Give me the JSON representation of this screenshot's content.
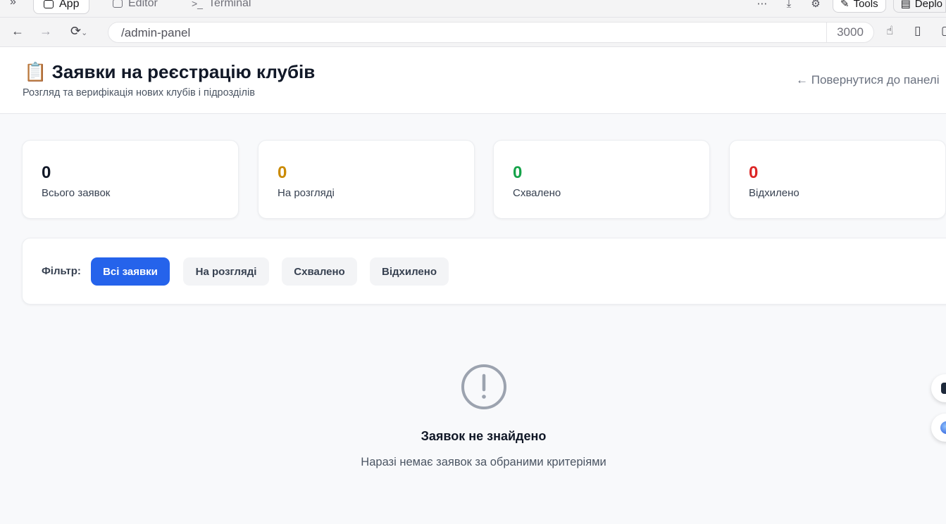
{
  "ide": {
    "tabs": [
      {
        "label": "App",
        "active": true
      },
      {
        "label": "Editor",
        "active": false
      },
      {
        "label": "Terminal",
        "active": false
      }
    ],
    "tools_label": "Tools",
    "deploy_label": "Deplo"
  },
  "browser": {
    "url": "/admin-panel",
    "port": "3000"
  },
  "header": {
    "icon": "📋",
    "title": "Заявки на реєстрацію клубів",
    "subtitle": "Розгляд та верифікація нових клубів і підрозділів",
    "back_link": "← Повернутися до панелі"
  },
  "stats": [
    {
      "value": "0",
      "label": "Всього заявок",
      "color": "#111827"
    },
    {
      "value": "0",
      "label": "На розгляді",
      "color": "#ca8a04"
    },
    {
      "value": "0",
      "label": "Схвалено",
      "color": "#16a34a"
    },
    {
      "value": "0",
      "label": "Відхилено",
      "color": "#dc2626"
    }
  ],
  "filter": {
    "label": "Фільтр:",
    "options": [
      "Всі заявки",
      "На розгляді",
      "Схвалено",
      "Відхилено"
    ],
    "selected": "Всі заявки",
    "accent": "#2563eb"
  },
  "empty": {
    "title": "Заявок не знайдено",
    "subtitle": "Наразі немає заявок за обраними критеріями"
  }
}
